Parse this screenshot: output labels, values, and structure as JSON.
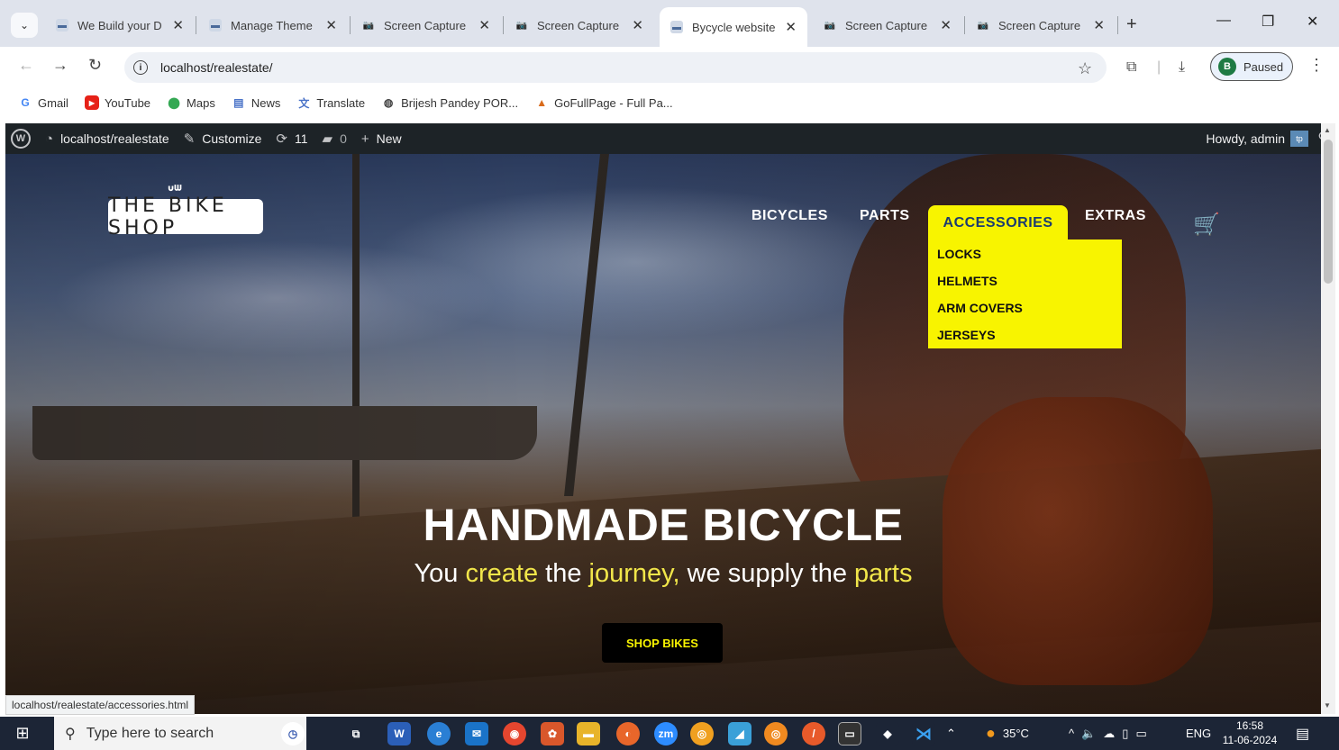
{
  "browser": {
    "tabs": [
      {
        "title": "We Build your D",
        "active": false
      },
      {
        "title": "Manage Theme",
        "active": false
      },
      {
        "title": "Screen Capture",
        "active": false
      },
      {
        "title": "Screen Capture",
        "active": false
      },
      {
        "title": "Bycycle website",
        "active": true
      },
      {
        "title": "Screen Capture",
        "active": false
      },
      {
        "title": "Screen Capture",
        "active": false
      }
    ],
    "url": "localhost/realestate/",
    "profile_initial": "B",
    "profile_label": "Paused",
    "bookmarks": [
      "Gmail",
      "YouTube",
      "Maps",
      "News",
      "Translate",
      "Brijesh Pandey POR...",
      "GoFullPage - Full Pa..."
    ],
    "status_link": "localhost/realestate/accessories.html"
  },
  "wpbar": {
    "site": "localhost/realestate",
    "customize": "Customize",
    "updates": "11",
    "comments": "0",
    "new": "New",
    "howdy": "Howdy, admin"
  },
  "site": {
    "logo": "THE BIKE SHOP",
    "nav": {
      "bicycles": "BICYCLES",
      "parts": "PARTS",
      "accessories": "ACCESSORIES",
      "extras": "EXTRAS"
    },
    "dropdown": [
      "LOCKS",
      "HELMETS",
      "ARM COVERS",
      "JERSEYS"
    ],
    "headline": "HANDMADE BICYCLE",
    "subline": {
      "w1": "You ",
      "h1": "create",
      "w2": " the ",
      "h2": "journey,",
      "w3": " we supply the ",
      "h3": "parts"
    },
    "cta": "SHOP BIKES"
  },
  "taskbar": {
    "search_placeholder": "Type here to search",
    "temperature": "35°C",
    "language": "ENG",
    "time": "16:58",
    "date": "11-06-2024"
  },
  "colors": {
    "accent_yellow": "#f8f400",
    "wp_bar": "#1d2327",
    "nav_active_text": "#1b3b70"
  }
}
